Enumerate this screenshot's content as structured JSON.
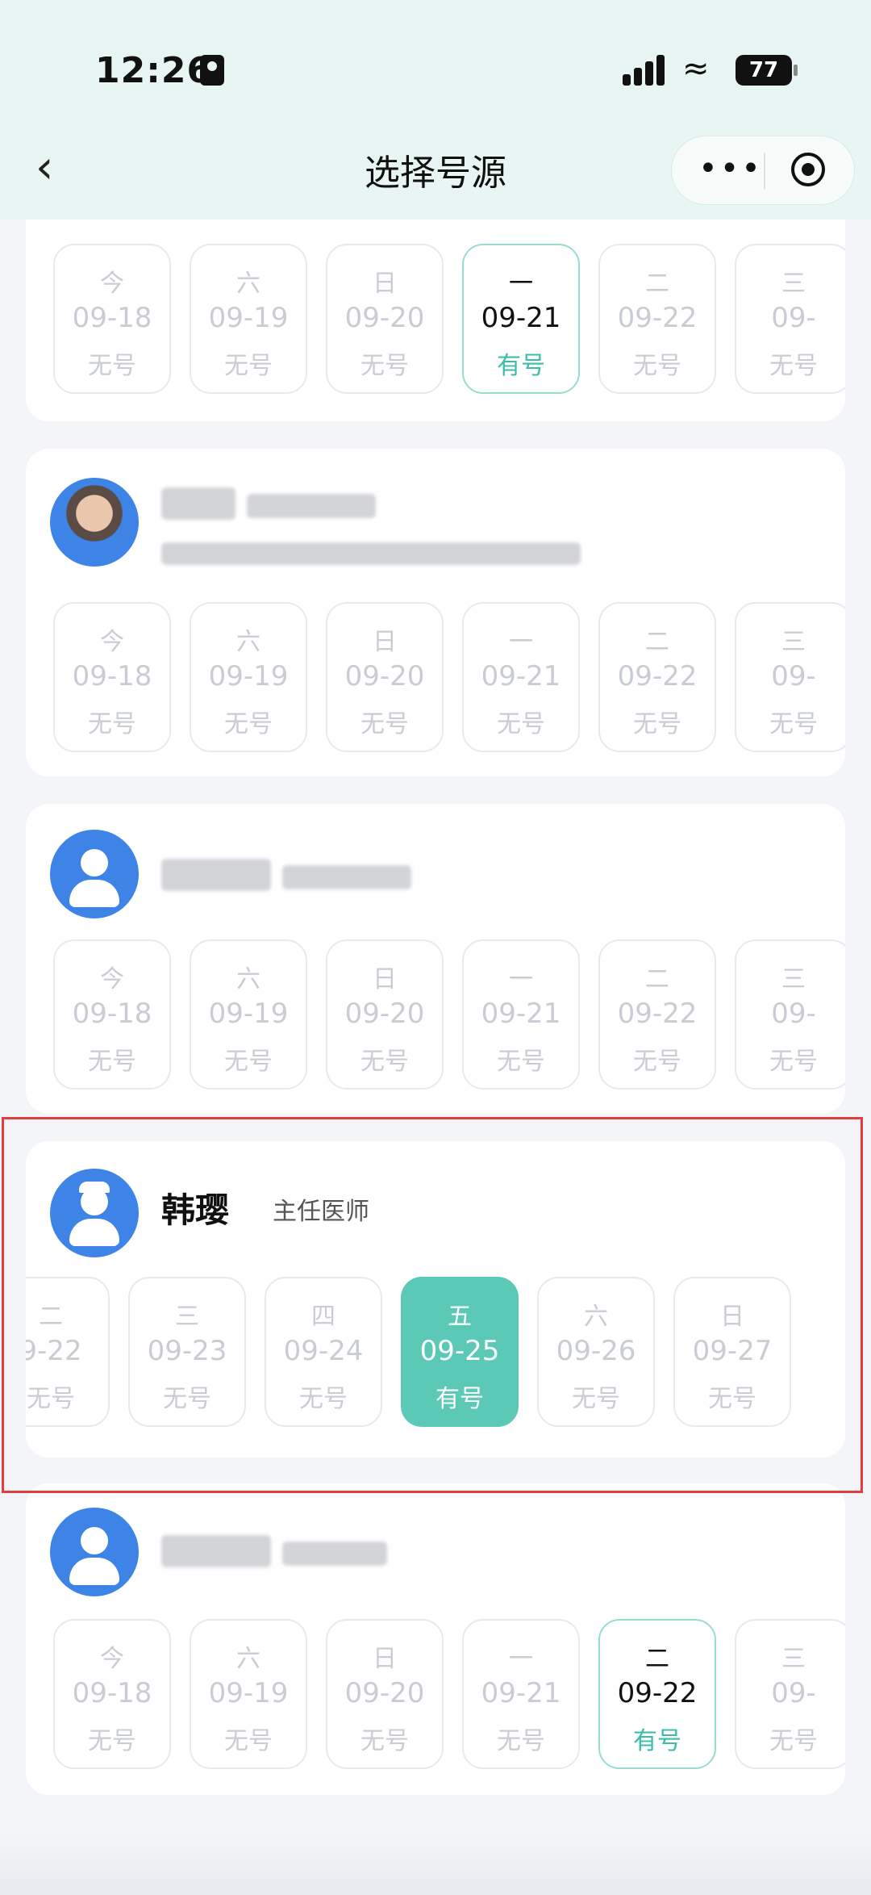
{
  "status_bar": {
    "time": "12:26",
    "battery": "77"
  },
  "nav": {
    "title": "选择号源",
    "back_icon": "chevron-left-icon",
    "more_icon": "more-dots-icon",
    "close_icon": "target-icon",
    "more_glyph": "•••"
  },
  "colors": {
    "accent": "#5cc9b7",
    "highlight": "#e23d3d",
    "avatar": "#3d84e6"
  },
  "cards": [
    {
      "doctor": {
        "name": "",
        "title": ""
      },
      "dates": [
        {
          "weekday": "今",
          "date": "09-18",
          "status": "无号"
        },
        {
          "weekday": "六",
          "date": "09-19",
          "status": "无号"
        },
        {
          "weekday": "日",
          "date": "09-20",
          "status": "无号"
        },
        {
          "weekday": "一",
          "date": "09-21",
          "status": "有号"
        },
        {
          "weekday": "二",
          "date": "09-22",
          "status": "无号"
        },
        {
          "weekday": "三",
          "date": "09-",
          "status": "无号"
        }
      ]
    },
    {
      "doctor": {
        "name": "",
        "title": ""
      },
      "dates": [
        {
          "weekday": "今",
          "date": "09-18",
          "status": "无号"
        },
        {
          "weekday": "六",
          "date": "09-19",
          "status": "无号"
        },
        {
          "weekday": "日",
          "date": "09-20",
          "status": "无号"
        },
        {
          "weekday": "一",
          "date": "09-21",
          "status": "无号"
        },
        {
          "weekday": "二",
          "date": "09-22",
          "status": "无号"
        },
        {
          "weekday": "三",
          "date": "09-",
          "status": "无号"
        }
      ]
    },
    {
      "doctor": {
        "name": "",
        "title": ""
      },
      "dates": [
        {
          "weekday": "今",
          "date": "09-18",
          "status": "无号"
        },
        {
          "weekday": "六",
          "date": "09-19",
          "status": "无号"
        },
        {
          "weekday": "日",
          "date": "09-20",
          "status": "无号"
        },
        {
          "weekday": "一",
          "date": "09-21",
          "status": "无号"
        },
        {
          "weekday": "二",
          "date": "09-22",
          "status": "无号"
        },
        {
          "weekday": "三",
          "date": "09-",
          "status": "无号"
        }
      ]
    },
    {
      "doctor": {
        "name": "韩璎",
        "title": "主任医师"
      },
      "dates": [
        {
          "weekday": "二",
          "date": "9-22",
          "status": "无号"
        },
        {
          "weekday": "三",
          "date": "09-23",
          "status": "无号"
        },
        {
          "weekday": "四",
          "date": "09-24",
          "status": "无号"
        },
        {
          "weekday": "五",
          "date": "09-25",
          "status": "有号"
        },
        {
          "weekday": "六",
          "date": "09-26",
          "status": "无号"
        },
        {
          "weekday": "日",
          "date": "09-27",
          "status": "无号"
        }
      ]
    },
    {
      "doctor": {
        "name": "",
        "title": ""
      },
      "dates": [
        {
          "weekday": "今",
          "date": "09-18",
          "status": "无号"
        },
        {
          "weekday": "六",
          "date": "09-19",
          "status": "无号"
        },
        {
          "weekday": "日",
          "date": "09-20",
          "status": "无号"
        },
        {
          "weekday": "一",
          "date": "09-21",
          "status": "无号"
        },
        {
          "weekday": "二",
          "date": "09-22",
          "status": "有号"
        },
        {
          "weekday": "三",
          "date": "09-",
          "status": "无号"
        }
      ]
    }
  ]
}
